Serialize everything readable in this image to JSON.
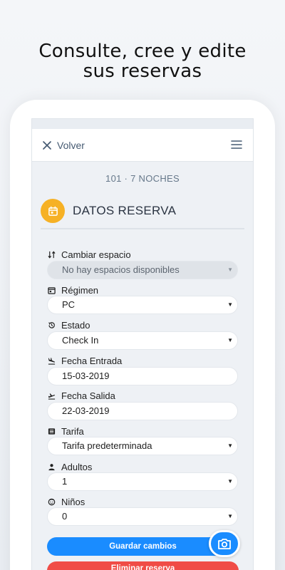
{
  "headline": {
    "line1": "Consulte, cree y edite",
    "line2": "sus reservas"
  },
  "topbar": {
    "back_label": "Volver"
  },
  "reservation": {
    "summary": "101 · 7 NOCHES",
    "section_title": "DATOS RESERVA"
  },
  "fields": [
    {
      "label": "Cambiar espacio",
      "value": "No hay espacios disponibles",
      "icon": "swap-arrows-icon",
      "kind": "select",
      "disabled": true
    },
    {
      "label": "Régimen",
      "value": "PC",
      "icon": "calendar-icon",
      "kind": "select"
    },
    {
      "label": "Estado",
      "value": "Check In",
      "icon": "history-icon",
      "kind": "select"
    },
    {
      "label": "Fecha Entrada",
      "value": "15-03-2019",
      "icon": "plane-landing-icon",
      "kind": "input"
    },
    {
      "label": "Fecha Salida",
      "value": "22-03-2019",
      "icon": "plane-takeoff-icon",
      "kind": "input"
    },
    {
      "label": "Tarifa",
      "value": "Tarifa predeterminada",
      "icon": "list-icon",
      "kind": "select"
    },
    {
      "label": "Adultos",
      "value": "1",
      "icon": "person-icon",
      "kind": "select"
    },
    {
      "label": "Niños",
      "value": "0",
      "icon": "child-face-icon",
      "kind": "select"
    }
  ],
  "actions": {
    "save_label": "Guardar cambios",
    "delete_label": "Eliminar reserva"
  },
  "colors": {
    "accent": "#1a8cff",
    "danger": "#f04c46",
    "section_icon": "#f6b125"
  }
}
